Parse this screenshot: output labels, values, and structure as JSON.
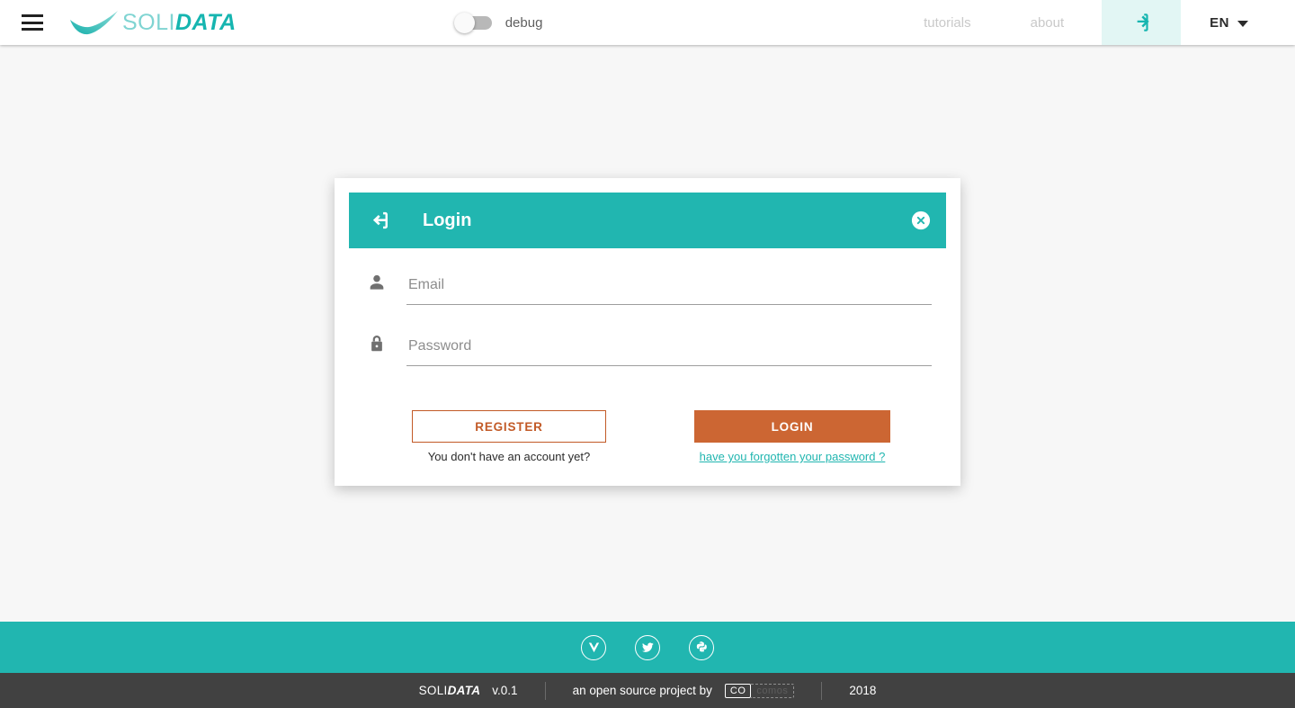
{
  "header": {
    "menu_icon": "hamburger-menu-icon",
    "brand": {
      "prefix": "SOLI",
      "suffix": "DATA"
    },
    "debug_toggle": {
      "label": "debug",
      "state": "off"
    },
    "nav": [
      {
        "label": "tutorials",
        "name": "tutorials"
      },
      {
        "label": "about",
        "name": "about"
      }
    ],
    "login_tab_icon": "login-arrow-icon",
    "language": {
      "value": "EN",
      "caret_icon": "chevron-down-icon"
    }
  },
  "card": {
    "icon": "login-arrow-icon",
    "title": "Login",
    "close_icon": "close-circle-icon",
    "fields": [
      {
        "name": "email",
        "icon": "person-icon",
        "placeholder": "Email",
        "value": ""
      },
      {
        "name": "password",
        "icon": "lock-icon",
        "placeholder": "Password",
        "value": ""
      }
    ],
    "register_button": "REGISTER",
    "login_button": "LOGIN",
    "register_hint": "You don't have an account yet?",
    "forgot_link": "have you forgotten your password ?"
  },
  "footer": {
    "social": [
      {
        "name": "vuejs",
        "icon": "vuejs-icon"
      },
      {
        "name": "twitter",
        "icon": "twitter-icon"
      },
      {
        "name": "python",
        "icon": "python-icon"
      }
    ],
    "brand_prefix": "SOLI",
    "brand_suffix": "DATA",
    "version": "v.0.1",
    "credit": "an open source project by",
    "cosmos_mark_left": "CO",
    "cosmos_mark_right": "comos",
    "year": "2018"
  },
  "colors": {
    "teal": "#21b6b0",
    "teal_light": "#e2f6f4",
    "orange": "#cc6633",
    "orange_border": "#c25a27",
    "dark": "#414141",
    "page_bg": "#f7f7f7"
  }
}
